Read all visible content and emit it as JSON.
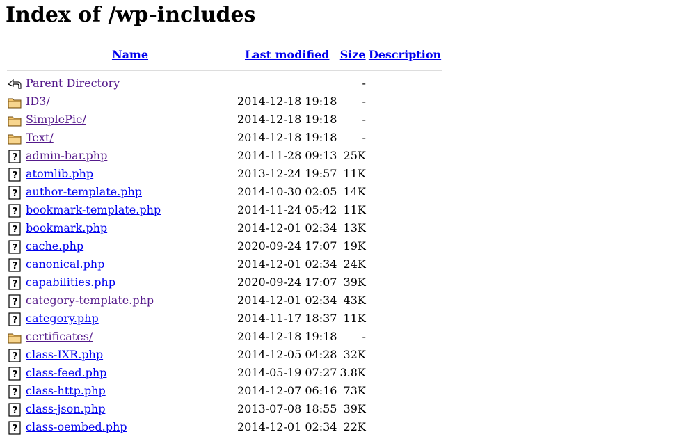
{
  "page": {
    "title": "Index of /wp-includes"
  },
  "columns": {
    "name": "Name",
    "last_modified": "Last modified",
    "size": "Size",
    "description": "Description"
  },
  "rows": [
    {
      "icon": "back-icon",
      "name": "Parent Directory",
      "date": "",
      "size": "-",
      "visited": true
    },
    {
      "icon": "folder-icon",
      "name": "ID3/",
      "date": "2014-12-18 19:18",
      "size": "-",
      "visited": true
    },
    {
      "icon": "folder-icon",
      "name": "SimplePie/",
      "date": "2014-12-18 19:18",
      "size": "-",
      "visited": true
    },
    {
      "icon": "folder-icon",
      "name": "Text/",
      "date": "2014-12-18 19:18",
      "size": "-",
      "visited": true
    },
    {
      "icon": "unknown-file-icon",
      "name": "admin-bar.php",
      "date": "2014-11-28 09:13",
      "size": "25K",
      "visited": true
    },
    {
      "icon": "unknown-file-icon",
      "name": "atomlib.php",
      "date": "2013-12-24 19:57",
      "size": "11K",
      "visited": false
    },
    {
      "icon": "unknown-file-icon",
      "name": "author-template.php",
      "date": "2014-10-30 02:05",
      "size": "14K",
      "visited": false
    },
    {
      "icon": "unknown-file-icon",
      "name": "bookmark-template.php",
      "date": "2014-11-24 05:42",
      "size": "11K",
      "visited": false
    },
    {
      "icon": "unknown-file-icon",
      "name": "bookmark.php",
      "date": "2014-12-01 02:34",
      "size": "13K",
      "visited": false
    },
    {
      "icon": "unknown-file-icon",
      "name": "cache.php",
      "date": "2020-09-24 17:07",
      "size": "19K",
      "visited": false
    },
    {
      "icon": "unknown-file-icon",
      "name": "canonical.php",
      "date": "2014-12-01 02:34",
      "size": "24K",
      "visited": false
    },
    {
      "icon": "unknown-file-icon",
      "name": "capabilities.php",
      "date": "2020-09-24 17:07",
      "size": "39K",
      "visited": false
    },
    {
      "icon": "unknown-file-icon",
      "name": "category-template.php",
      "date": "2014-12-01 02:34",
      "size": "43K",
      "visited": true
    },
    {
      "icon": "unknown-file-icon",
      "name": "category.php",
      "date": "2014-11-17 18:37",
      "size": "11K",
      "visited": false
    },
    {
      "icon": "folder-icon",
      "name": "certificates/",
      "date": "2014-12-18 19:18",
      "size": "-",
      "visited": true
    },
    {
      "icon": "unknown-file-icon",
      "name": "class-IXR.php",
      "date": "2014-12-05 04:28",
      "size": "32K",
      "visited": false
    },
    {
      "icon": "unknown-file-icon",
      "name": "class-feed.php",
      "date": "2014-05-19 07:27",
      "size": "3.8K",
      "visited": false
    },
    {
      "icon": "unknown-file-icon",
      "name": "class-http.php",
      "date": "2014-12-07 06:16",
      "size": "73K",
      "visited": false
    },
    {
      "icon": "unknown-file-icon",
      "name": "class-json.php",
      "date": "2013-07-08 18:55",
      "size": "39K",
      "visited": false
    },
    {
      "icon": "unknown-file-icon",
      "name": "class-oembed.php",
      "date": "2014-12-01 02:34",
      "size": "22K",
      "visited": false
    }
  ]
}
